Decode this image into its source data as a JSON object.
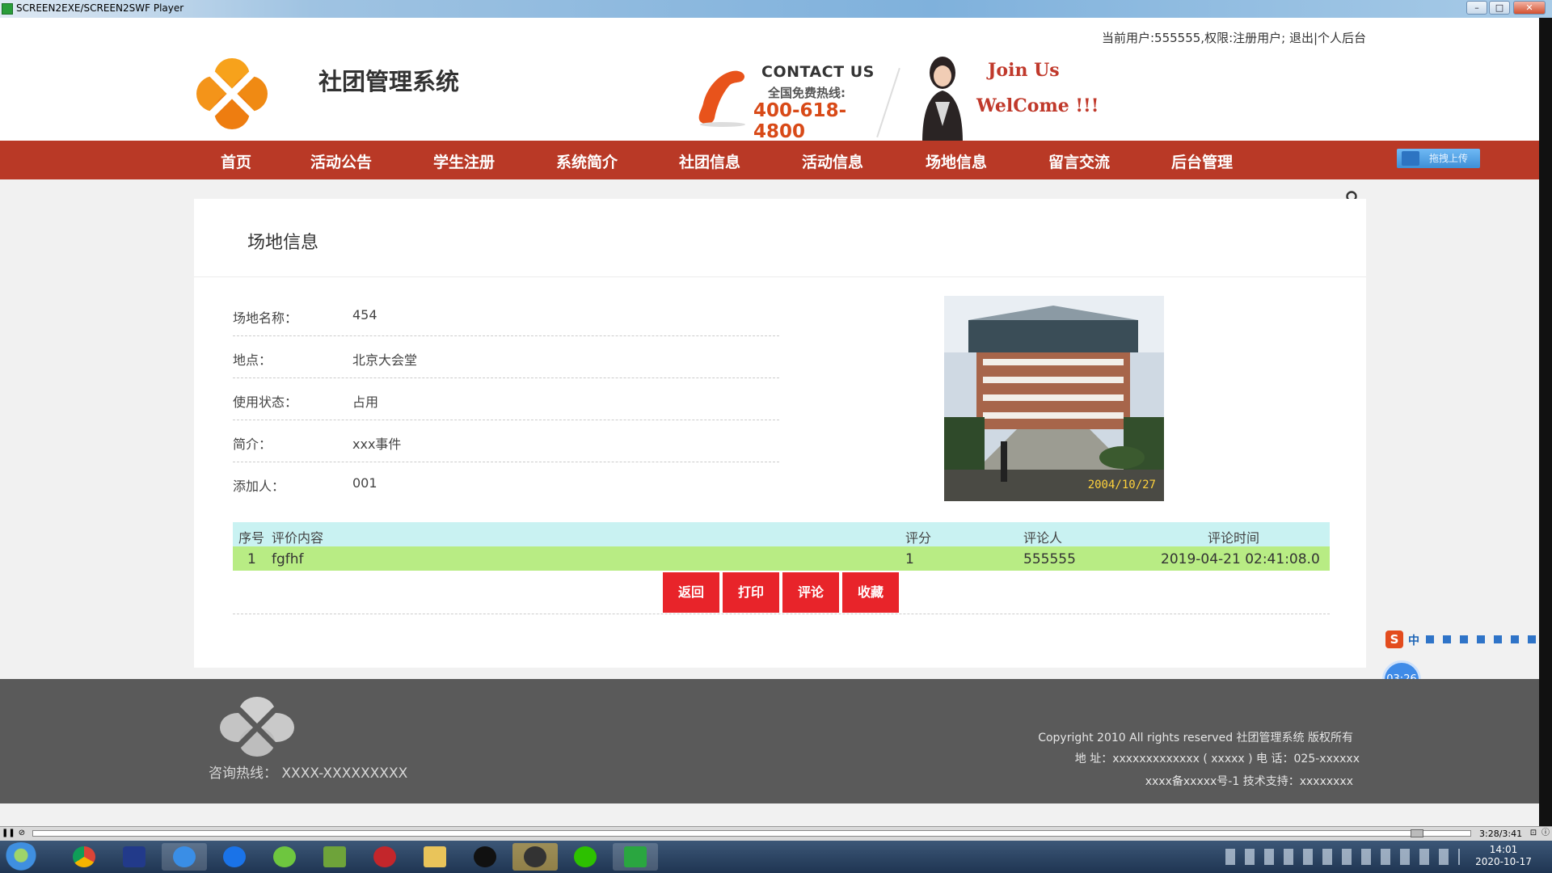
{
  "window": {
    "title": "SCREEN2EXE/SCREEN2SWF Player",
    "minimize": "–",
    "maximize": "□",
    "close": "✕"
  },
  "header": {
    "user_info": "当前用户:555555,权限:注册用户; 退出|个人后台",
    "site_title": "社团管理系统",
    "contact_title": "CONTACT US",
    "contact_sub": "全国免费热线:",
    "contact_tel": "400-618-4800",
    "join_line1": "Join Us",
    "join_line2": "WelCome !!!"
  },
  "nav": {
    "items": [
      "首页",
      "活动公告",
      "学生注册",
      "系统简介",
      "社团信息",
      "活动信息",
      "场地信息",
      "留言交流",
      "后台管理"
    ],
    "upload_label": "拖拽上传"
  },
  "panel": {
    "title": "场地信息",
    "fields": [
      {
        "label": "场地名称：",
        "value": "454"
      },
      {
        "label": "地点：",
        "value": "北京大会堂"
      },
      {
        "label": "使用状态：",
        "value": "占用"
      },
      {
        "label": "简介：",
        "value": "xxx事件"
      },
      {
        "label": "添加人：",
        "value": "001"
      }
    ],
    "photo_stamp": "2004/10/27"
  },
  "reviews": {
    "headers": {
      "index": "序号",
      "content": "评价内容",
      "score": "评分",
      "reviewer": "评论人",
      "time": "评论时间"
    },
    "rows": [
      {
        "index": "1",
        "content": "fgfhf",
        "score": "1",
        "reviewer": "555555",
        "time": "2019-04-21 02:41:08.0"
      }
    ]
  },
  "actions": {
    "back": "返回",
    "print": "打印",
    "comment": "评论",
    "favorite": "收藏"
  },
  "ime": {
    "logo": "S",
    "mode": "中"
  },
  "recorder_timer": "03:26",
  "footer": {
    "hotline": "咨询热线：  XXXX-XXXXXXXXX",
    "copyright": "Copyright 2010 All rights reserved 社团管理系统 版权所有",
    "address": "地    址：xxxxxxxxxxxxx ( xxxxx ) 电    话：025-xxxxxx",
    "icp": "xxxx备xxxxx号-1 技术支持：xxxxxxxx"
  },
  "player": {
    "time": "3:28/3:41"
  },
  "taskbar": {
    "time": "14:01",
    "date": "2020-10-17"
  }
}
